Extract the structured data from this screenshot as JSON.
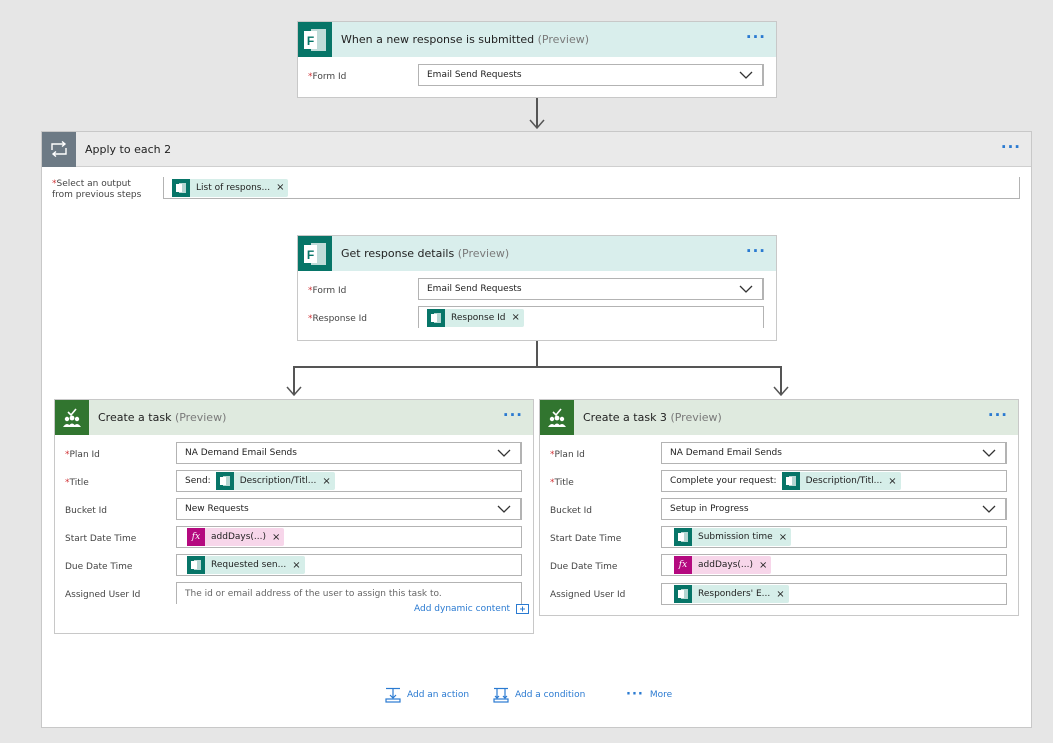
{
  "trigger": {
    "title": "When a new response is submitted",
    "preview": "(Preview)",
    "form_id_label": "Form Id",
    "form_id_value": "Email Send Requests"
  },
  "apply_each": {
    "title": "Apply to each 2",
    "select_label_line1": "Select an output",
    "select_label_line2": "from previous steps",
    "token": "List of respons..."
  },
  "get_response": {
    "title": "Get response details",
    "preview": "(Preview)",
    "form_id_label": "Form Id",
    "form_id_value": "Email Send Requests",
    "response_id_label": "Response Id",
    "response_id_token": "Response Id"
  },
  "task1": {
    "title": "Create a task",
    "preview": "(Preview)",
    "plan_id_label": "Plan Id",
    "plan_id_value": "NA Demand Email Sends",
    "title_label": "Title",
    "title_prefix": "Send:",
    "title_token": "Description/Titl...",
    "bucket_label": "Bucket Id",
    "bucket_value": "New Requests",
    "start_label": "Start Date Time",
    "start_token": "addDays(...)",
    "due_label": "Due Date Time",
    "due_token": "Requested sen...",
    "assigned_label": "Assigned User Id",
    "assigned_placeholder": "The id or email address of the user to assign this task to.",
    "add_dynamic": "Add dynamic content"
  },
  "task3": {
    "title": "Create a task 3",
    "preview": "(Preview)",
    "plan_id_label": "Plan Id",
    "plan_id_value": "NA Demand Email Sends",
    "title_label": "Title",
    "title_prefix": "Complete your request:",
    "title_token": "Description/Titl...",
    "bucket_label": "Bucket Id",
    "bucket_value": "Setup in Progress",
    "start_label": "Start Date Time",
    "start_token": "Submission time",
    "due_label": "Due Date Time",
    "due_token": "addDays(...)",
    "assigned_label": "Assigned User Id",
    "assigned_token": "Responders' E..."
  },
  "footer": {
    "add_action": "Add an action",
    "add_condition": "Add a condition",
    "more": "More"
  },
  "common": {
    "dots": "···",
    "required_mark": "*",
    "close_glyph": "×",
    "fx_glyph": "fx"
  },
  "colors": {
    "forms_brand": "#077568",
    "planner_brand": "#31752f",
    "expression": "#b4097f",
    "link": "#2a7ad1",
    "required": "#d13438"
  }
}
